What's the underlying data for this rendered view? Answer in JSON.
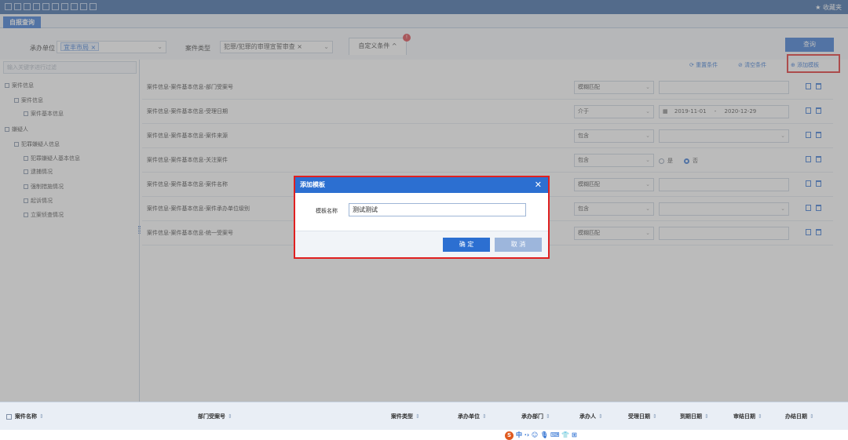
{
  "topbar": {
    "favorites": "★ 收藏夹"
  },
  "tabs": [
    {
      "label": "自报查询"
    }
  ],
  "filters": {
    "unit_label": "承办单位",
    "unit_chip": "宜丰市局 ×",
    "type_label": "案件类型",
    "type_value": "犯罪/犯罪的审理宣誓审查 ×",
    "custom_tab": "自定义条件 ^",
    "badge": "!",
    "query": "查询"
  },
  "sidebar": {
    "search_placeholder": "输入关键字进行过滤",
    "tree": [
      {
        "label": "案件信息"
      },
      {
        "label": "案件信息"
      },
      {
        "label": "案件基本信息"
      },
      {
        "label": "嫌疑人"
      },
      {
        "label": "犯罪嫌疑人信息"
      },
      {
        "label": "犯罪嫌疑人基本信息"
      },
      {
        "label": "逮捕情况"
      },
      {
        "label": "强制措施情况"
      },
      {
        "label": "起诉情况"
      },
      {
        "label": "立案侦查情况"
      }
    ]
  },
  "actions": {
    "reset": "⟳ 重置条件",
    "clear": "⊘ 清空条件",
    "add_template": "⊕ 添加模板"
  },
  "conditions": [
    {
      "label": "案件信息-案件基本信息-部门受案号",
      "op": "模糊匹配",
      "value": "",
      "type": "text"
    },
    {
      "label": "案件信息-案件基本信息-受理日期",
      "op": "介于",
      "from": "2019-11-01",
      "sep": "-",
      "to": "2020-12-29",
      "type": "date"
    },
    {
      "label": "案件信息-案件基本信息-案件来源",
      "op": "包含",
      "value": "",
      "type": "select"
    },
    {
      "label": "案件信息-案件基本信息-关注案件",
      "op": "包含",
      "yes": "是",
      "no": "否",
      "type": "radio"
    },
    {
      "label": "案件信息-案件基本信息-案件名称",
      "op": "模糊匹配",
      "value": "",
      "type": "text"
    },
    {
      "label": "案件信息-案件基本信息-案件承办单位级别",
      "op": "包含",
      "value": "",
      "type": "select"
    },
    {
      "label": "案件信息-案件基本信息-统一受案号",
      "op": "模糊匹配",
      "value": "",
      "type": "text"
    }
  ],
  "modal": {
    "title": "添加模板",
    "close": "✕",
    "field_label": "模板名称",
    "field_value": "测试测试",
    "ok": "确 定",
    "cancel": "取 消"
  },
  "grid_columns": [
    {
      "label": "案件名称"
    },
    {
      "label": "部门受案号"
    },
    {
      "label": "案件类型"
    },
    {
      "label": "承办单位"
    },
    {
      "label": "承办部门"
    },
    {
      "label": "承办人"
    },
    {
      "label": "受理日期"
    },
    {
      "label": "到期日期"
    },
    {
      "label": "审结日期"
    },
    {
      "label": "办结日期"
    }
  ],
  "sort_marker": "⇕",
  "ime": {
    "icon": "S",
    "text": "中 ·› ☺ 🎙 ⌨ 👕 ⊞"
  }
}
